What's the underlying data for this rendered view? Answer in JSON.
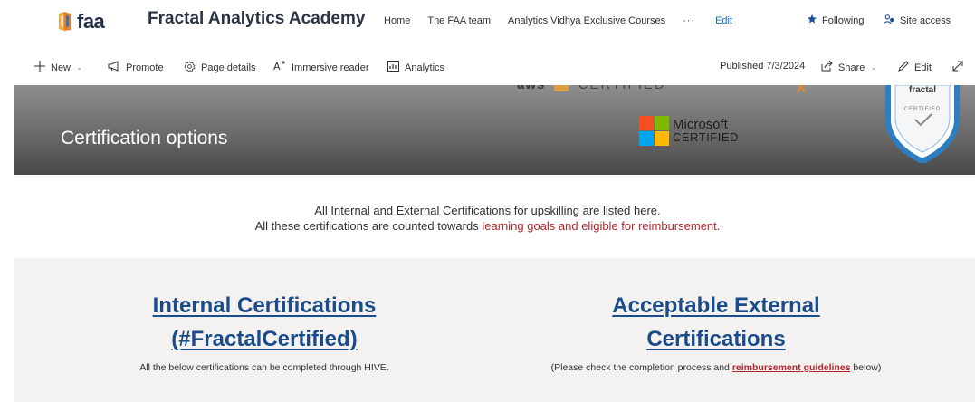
{
  "header": {
    "logo_text": "faa",
    "site_title": "Fractal Analytics Academy",
    "nav": [
      "Home",
      "The FAA team",
      "Analytics Vidhya Exclusive Courses"
    ],
    "more": "···",
    "edit": "Edit",
    "following": "Following",
    "site_access": "Site access"
  },
  "commands": {
    "new": "New",
    "promote": "Promote",
    "page_details": "Page details",
    "immersive_reader": "Immersive reader",
    "analytics": "Analytics",
    "published": "Published 7/3/2024",
    "share": "Share",
    "edit": "Edit"
  },
  "banner": {
    "title": "Certification options",
    "aws_fragment": "aws",
    "aws_certified_fragment": "CERTIFIED",
    "microsoft": "Microsoft",
    "certified": "CERTIFIED",
    "badge_top": "fractal",
    "badge_certified": "CERTIFIED"
  },
  "intro": {
    "line1": "All Internal and External Certifications for upskilling are listed here.",
    "line2_prefix": "All these certifications are counted towards ",
    "line2_accent": "learning goals and eligible for reimbursement."
  },
  "internal": {
    "heading_line1": "Internal Certifications",
    "heading_line2": "(#FractalCertified)",
    "subtext": "All the below certifications can be completed through HIVE."
  },
  "external": {
    "heading_line1": "Acceptable External",
    "heading_line2": "Certifications ",
    "subtext_prefix": "(Please check the completion process and ",
    "subtext_link": "reimbursement guidelines",
    "subtext_suffix": " below)"
  },
  "colors": {
    "accent_red": "#b1262d",
    "heading_blue": "#1a4b8a",
    "link_blue": "#0f6cbd",
    "section_bg": "#f3f2f1"
  },
  "icons": [
    "faa-logo-icon",
    "star-icon",
    "people-icon",
    "plus-icon",
    "megaphone-icon",
    "gear-icon",
    "immersive-reader-icon",
    "analytics-icon",
    "share-icon",
    "pencil-icon",
    "expand-icon"
  ]
}
